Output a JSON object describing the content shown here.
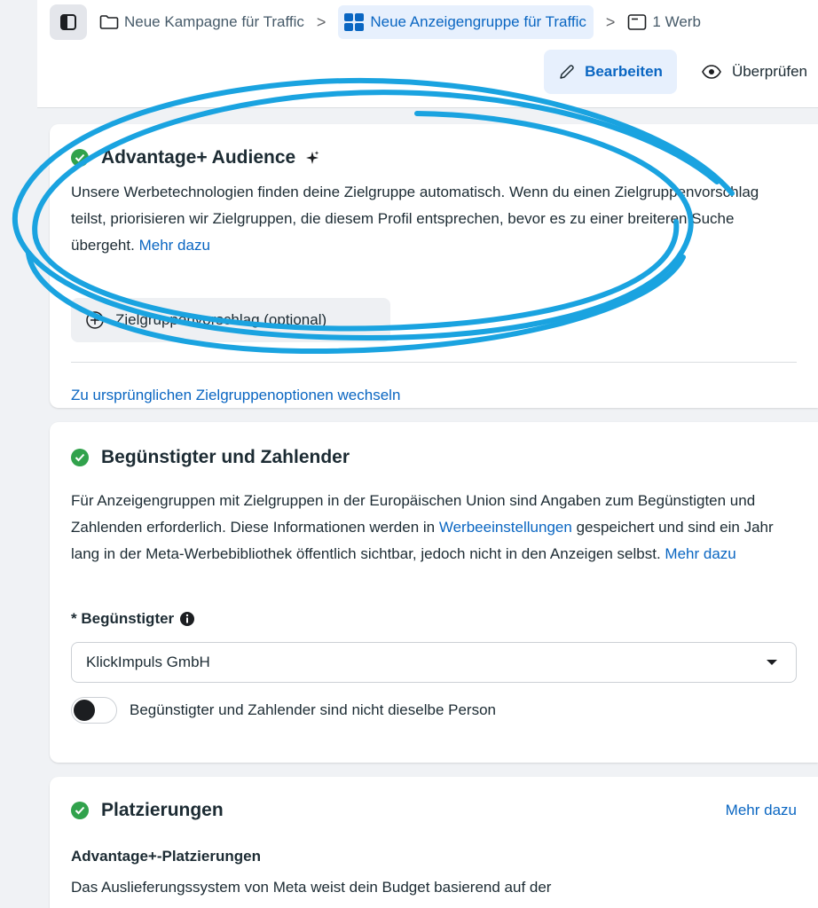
{
  "breadcrumb": {
    "campaign": "Neue Kampagne für Traffic",
    "adset": "Neue Anzeigengruppe für Traffic",
    "ad": "1 Werb",
    "separator": ">"
  },
  "actions": {
    "edit": "Bearbeiten",
    "review": "Überprüfen"
  },
  "audience_card": {
    "title": "Advantage+ Audience",
    "description": "Unsere Werbetechnologien finden deine Zielgruppe automatisch. Wenn du einen Zielgruppenvorschlag teilst, priorisieren wir Zielgruppen, die diesem Profil entsprechen, bevor es zu einer breiteren Suche übergeht.",
    "learn_more": "Mehr dazu",
    "suggest_button": "Zielgruppenvorschlag (optional)",
    "switch_link": "Zu ursprünglichen Zielgruppenoptionen wechseln"
  },
  "beneficiary_card": {
    "title": "Begünstigter und Zahlender",
    "description_1": "Für Anzeigengruppen mit Zielgruppen in der Europäischen Union sind Angaben zum Begünstigten und Zahlenden erforderlich. Diese Informationen werden in",
    "settings_link": "Werbeeinstellungen",
    "description_2": "gespeichert und sind ein Jahr lang in der Meta-Werbebibliothek öffentlich sichtbar, jedoch nicht in den Anzeigen selbst.",
    "learn_more": "Mehr dazu",
    "field_label": "* Begünstigter",
    "selected_value": "KlickImpuls GmbH",
    "toggle_label": "Begünstigter und Zahlender sind nicht dieselbe Person",
    "toggle_on": false
  },
  "placements_card": {
    "title": "Platzierungen",
    "learn_more": "Mehr dazu",
    "subtitle": "Advantage+-Platzierungen",
    "description": "Das Auslieferungssystem von Meta weist dein Budget basierend auf der"
  },
  "colors": {
    "accent": "#0a66c2",
    "success": "#31a24c",
    "scribble": "#1aa3e0"
  }
}
